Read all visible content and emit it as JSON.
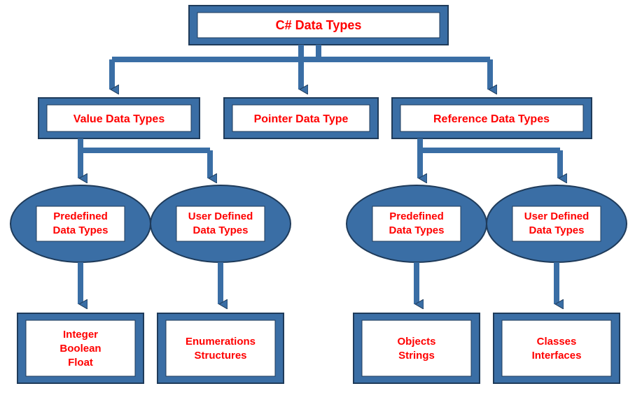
{
  "root": {
    "title": "C# Data Types"
  },
  "level2": {
    "value": {
      "title": "Value Data Types"
    },
    "pointer": {
      "title": "Pointer Data Type"
    },
    "reference": {
      "title": "Reference Data Types"
    }
  },
  "level3": {
    "value_predefined": {
      "line1": "Predefined",
      "line2": "Data Types"
    },
    "value_userdefined": {
      "line1": "User Defined",
      "line2": "Data Types"
    },
    "reference_predefined": {
      "line1": "Predefined",
      "line2": "Data Types"
    },
    "reference_userdefined": {
      "line1": "User Defined",
      "line2": "Data Types"
    }
  },
  "level4": {
    "value_predefined_items": {
      "line1": "Integer",
      "line2": "Boolean",
      "line3": "Float"
    },
    "value_userdefined_items": {
      "line1": "Enumerations",
      "line2": "Structures"
    },
    "reference_predefined_items": {
      "line1": "Objects",
      "line2": "Strings"
    },
    "reference_userdefined_items": {
      "line1": "Classes",
      "line2": "Interfaces"
    }
  },
  "chart_data": {
    "type": "tree",
    "title": "C# Data Types Hierarchy",
    "root": {
      "name": "C# Data Types",
      "children": [
        {
          "name": "Value Data Types",
          "children": [
            {
              "name": "Predefined Data Types",
              "children": [
                "Integer",
                "Boolean",
                "Float"
              ]
            },
            {
              "name": "User Defined Data Types",
              "children": [
                "Enumerations",
                "Structures"
              ]
            }
          ]
        },
        {
          "name": "Pointer Data Type",
          "children": []
        },
        {
          "name": "Reference Data Types",
          "children": [
            {
              "name": "Predefined Data Types",
              "children": [
                "Objects",
                "Strings"
              ]
            },
            {
              "name": "User Defined Data Types",
              "children": [
                "Classes",
                "Interfaces"
              ]
            }
          ]
        }
      ]
    }
  }
}
